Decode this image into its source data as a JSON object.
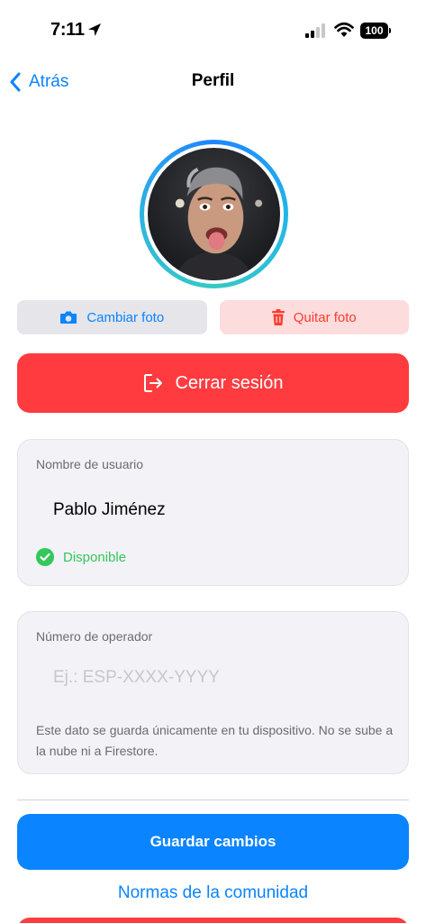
{
  "status_bar": {
    "time": "7:11",
    "battery": "100"
  },
  "nav": {
    "back_label": "Atrás",
    "title": "Perfil"
  },
  "photo_actions": {
    "change_label": "Cambiar foto",
    "remove_label": "Quitar foto"
  },
  "logout_label": "Cerrar sesión",
  "username_card": {
    "label": "Nombre de usuario",
    "value": "Pablo Jiménez",
    "status": "Disponible"
  },
  "operator_card": {
    "label": "Número de operador",
    "placeholder": "Ej.: ESP-XXXX-YYYY",
    "value": "",
    "note": "Este dato se guarda únicamente en tu dispositivo. No se sube a la nube ni a Firestore."
  },
  "save_label": "Guardar cambios",
  "community_label": "Normas de la comunidad",
  "colors": {
    "accent": "#0a84ff",
    "destructive": "#ff3b3f",
    "available": "#34c759"
  }
}
